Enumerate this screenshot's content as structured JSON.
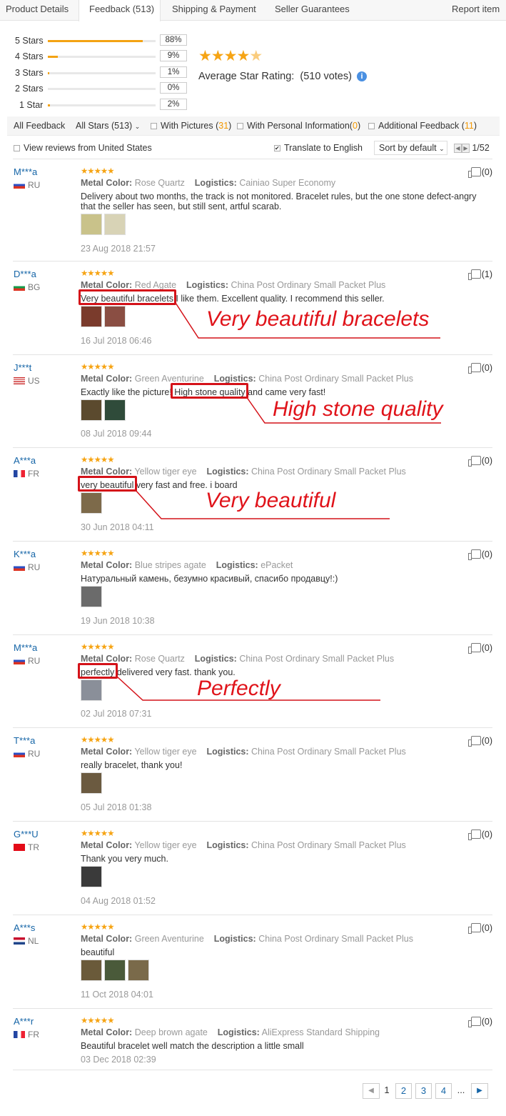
{
  "tabs": [
    {
      "label": "Product Details"
    },
    {
      "label": "Feedback (513)"
    },
    {
      "label": "Shipping & Payment"
    },
    {
      "label": "Seller Guarantees"
    }
  ],
  "report_item": "Report item",
  "rating_summary": {
    "rows": [
      {
        "label": "5 Stars",
        "percent": "88%",
        "fill": 0.88
      },
      {
        "label": "4 Stars",
        "percent": "9%",
        "fill": 0.09
      },
      {
        "label": "3 Stars",
        "percent": "1%",
        "fill": 0.01
      },
      {
        "label": "2 Stars",
        "percent": "0%",
        "fill": 0.0
      },
      {
        "label": "1 Star",
        "percent": "2%",
        "fill": 0.02
      }
    ],
    "average_label": "Average Star Rating:",
    "votes": "(510 votes)",
    "average_stars": 4.8
  },
  "filters": {
    "all_feedback": "All Feedback",
    "all_stars": "All Stars (513)",
    "with_pictures": "With Pictures (",
    "with_pictures_count": "31",
    "with_personal": "With Personal Information(",
    "with_personal_count": "0",
    "additional": "Additional Feedback (",
    "additional_count": "11",
    "close_paren": ")"
  },
  "options": {
    "view_us": "View reviews from United States",
    "translate": "Translate to English",
    "sort": "Sort by default",
    "page_info": "1/52"
  },
  "labels": {
    "metal_color": "Metal Color:",
    "logistics": "Logistics:"
  },
  "reviews": [
    {
      "user": "M***a",
      "country": "RU",
      "color": "Rose Quartz",
      "logistics": "Cainiao Super Economy",
      "text": "Delivery about two months, the track is not monitored. Bracelet rules, but the one stone defect-angry that the seller has seen, but still sent, artful scarab.",
      "date": "23 Aug 2018 21:57",
      "likes": "(0)"
    },
    {
      "user": "D***a",
      "country": "BG",
      "color": "Red Agate",
      "logistics": "China Post Ordinary Small Packet Plus",
      "text": "Very beautiful bracelets I like them. Excellent quality. I recommend this seller.",
      "date": "16 Jul 2018 06:46",
      "likes": "(1)"
    },
    {
      "user": "J***t",
      "country": "US",
      "color": "Green Aventurine",
      "logistics": "China Post Ordinary Small Packet Plus",
      "text": "Exactly like the picture! High stone quality and came very fast!",
      "date": "08 Jul 2018 09:44",
      "likes": "(0)"
    },
    {
      "user": "A***a",
      "country": "FR",
      "color": "Yellow tiger eye",
      "logistics": "China Post Ordinary Small Packet Plus",
      "text": "very beautiful very fast and free. i board",
      "date": "30 Jun 2018 04:11",
      "likes": "(0)"
    },
    {
      "user": "K***a",
      "country": "RU",
      "color": "Blue stripes agate",
      "logistics": "ePacket",
      "text": "Натуральный камень, безумно красивый, спасибо продавцу!:)",
      "date": "19 Jun 2018 10:38",
      "likes": "(0)"
    },
    {
      "user": "M***a",
      "country": "RU",
      "color": "Rose Quartz",
      "logistics": "China Post Ordinary Small Packet Plus",
      "text": "perfectly delivered very fast. thank you.",
      "date": "02 Jul 2018 07:31",
      "likes": "(0)"
    },
    {
      "user": "T***a",
      "country": "RU",
      "color": "Yellow tiger eye",
      "logistics": "China Post Ordinary Small Packet Plus",
      "text": "really bracelet, thank you!",
      "date": "05 Jul 2018 01:38",
      "likes": "(0)"
    },
    {
      "user": "G***U",
      "country": "TR",
      "color": "Yellow tiger eye",
      "logistics": "China Post Ordinary Small Packet Plus",
      "text": "Thank you very much.",
      "date": "04 Aug 2018 01:52",
      "likes": "(0)"
    },
    {
      "user": "A***s",
      "country": "NL",
      "color": "Green Aventurine",
      "logistics": "China Post Ordinary Small Packet Plus",
      "text": "beautiful",
      "date": "11 Oct 2018 04:01",
      "likes": "(0)"
    },
    {
      "user": "A***r",
      "country": "FR",
      "color": "Deep brown agate",
      "logistics": "AliExpress Standard Shipping",
      "text": "Beautiful bracelet well match the description a little small",
      "date": "03 Dec 2018 02:39",
      "likes": "(0)"
    }
  ],
  "callouts": {
    "c1": "Very beautiful bracelets",
    "c2": "High stone quality",
    "c3": "Very beautiful",
    "c4": "Perfectly"
  },
  "pagination": {
    "pages": [
      "1",
      "2",
      "3",
      "4"
    ],
    "ellipsis": "..."
  },
  "colors": {
    "star": "#f6a414",
    "link": "#1565a7",
    "highlight": "#e0131a",
    "orange": "#f39800"
  }
}
